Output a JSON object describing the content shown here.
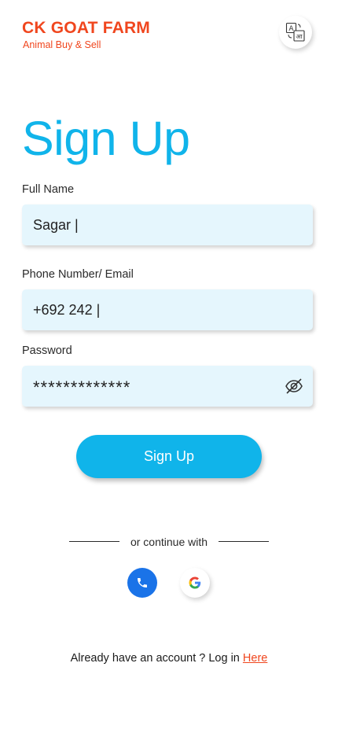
{
  "brand": {
    "name": "CK GOAT FARM",
    "tagline": "Animal Buy & Sell"
  },
  "language_button": {
    "icon": "translate-icon"
  },
  "page_title": "Sign Up",
  "form": {
    "full_name": {
      "label": "Full Name",
      "value": "Sagar |"
    },
    "contact": {
      "label": "Phone Number/ Email",
      "value": "+692 242 |"
    },
    "password": {
      "label": "Password",
      "value": "*************",
      "toggle_icon": "eye-off-icon"
    }
  },
  "signup_button": "Sign Up",
  "divider_text": "or continue with",
  "social": [
    {
      "name": "phone",
      "icon": "phone-icon"
    },
    {
      "name": "google",
      "icon": "google-icon"
    }
  ],
  "footer": {
    "text": "Already have an account ? Log in ",
    "link": "Here"
  },
  "colors": {
    "brand": "#f0461e",
    "accent": "#10b4ea",
    "field_bg": "#e5f6fd",
    "phone": "#1a73e8"
  }
}
